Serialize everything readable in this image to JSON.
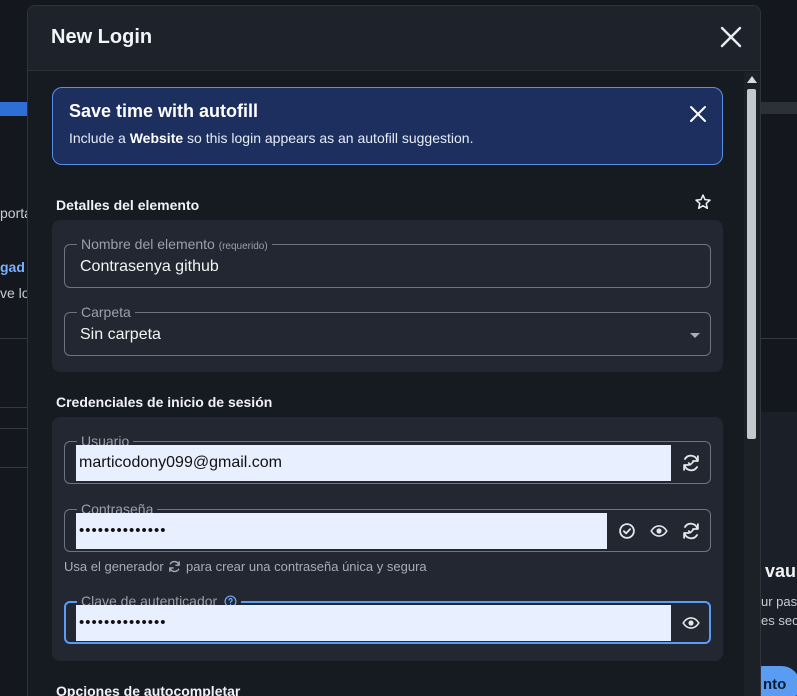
{
  "background": {
    "fragment_1": "porta",
    "fragment_2": "gad",
    "fragment_3": "ve lo",
    "fragment_4": "vault",
    "fragment_5": "ur pas",
    "fragment_6": "es sec",
    "button_fragment": "nto"
  },
  "dialog": {
    "title": "New Login"
  },
  "banner": {
    "title": "Save time with autofill",
    "text_prefix": "Include a",
    "text_bold": "Website",
    "text_suffix": "so this login appears as an autofill suggestion."
  },
  "details": {
    "heading": "Detalles del elemento",
    "name_label": "Nombre del elemento",
    "name_required": "(requerido)",
    "name_value": "Contrasenya github",
    "folder_label": "Carpeta",
    "folder_value": "Sin carpeta"
  },
  "credentials": {
    "heading": "Credenciales de inicio de sesión",
    "username_label": "Usuario",
    "username_value": "marticodony099@gmail.com",
    "password_label": "Contraseña",
    "password_value": "••••••••••••••",
    "generator_hint_prefix": "Usa el generador",
    "generator_hint_suffix": "para crear una contraseña única y segura",
    "totp_label": "Clave de autenticador",
    "totp_value": "••••••••••••••"
  },
  "autofill_options": {
    "heading": "Opciones de autocompletar"
  },
  "colors": {
    "accent": "#5b9cf3",
    "banner_bg": "#1c2f5e",
    "dialog_bg": "#161a21",
    "card_bg": "#232731"
  },
  "icons": [
    "close-icon",
    "star-icon",
    "generate-icon",
    "check-circle-icon",
    "eye-icon",
    "help-icon"
  ]
}
